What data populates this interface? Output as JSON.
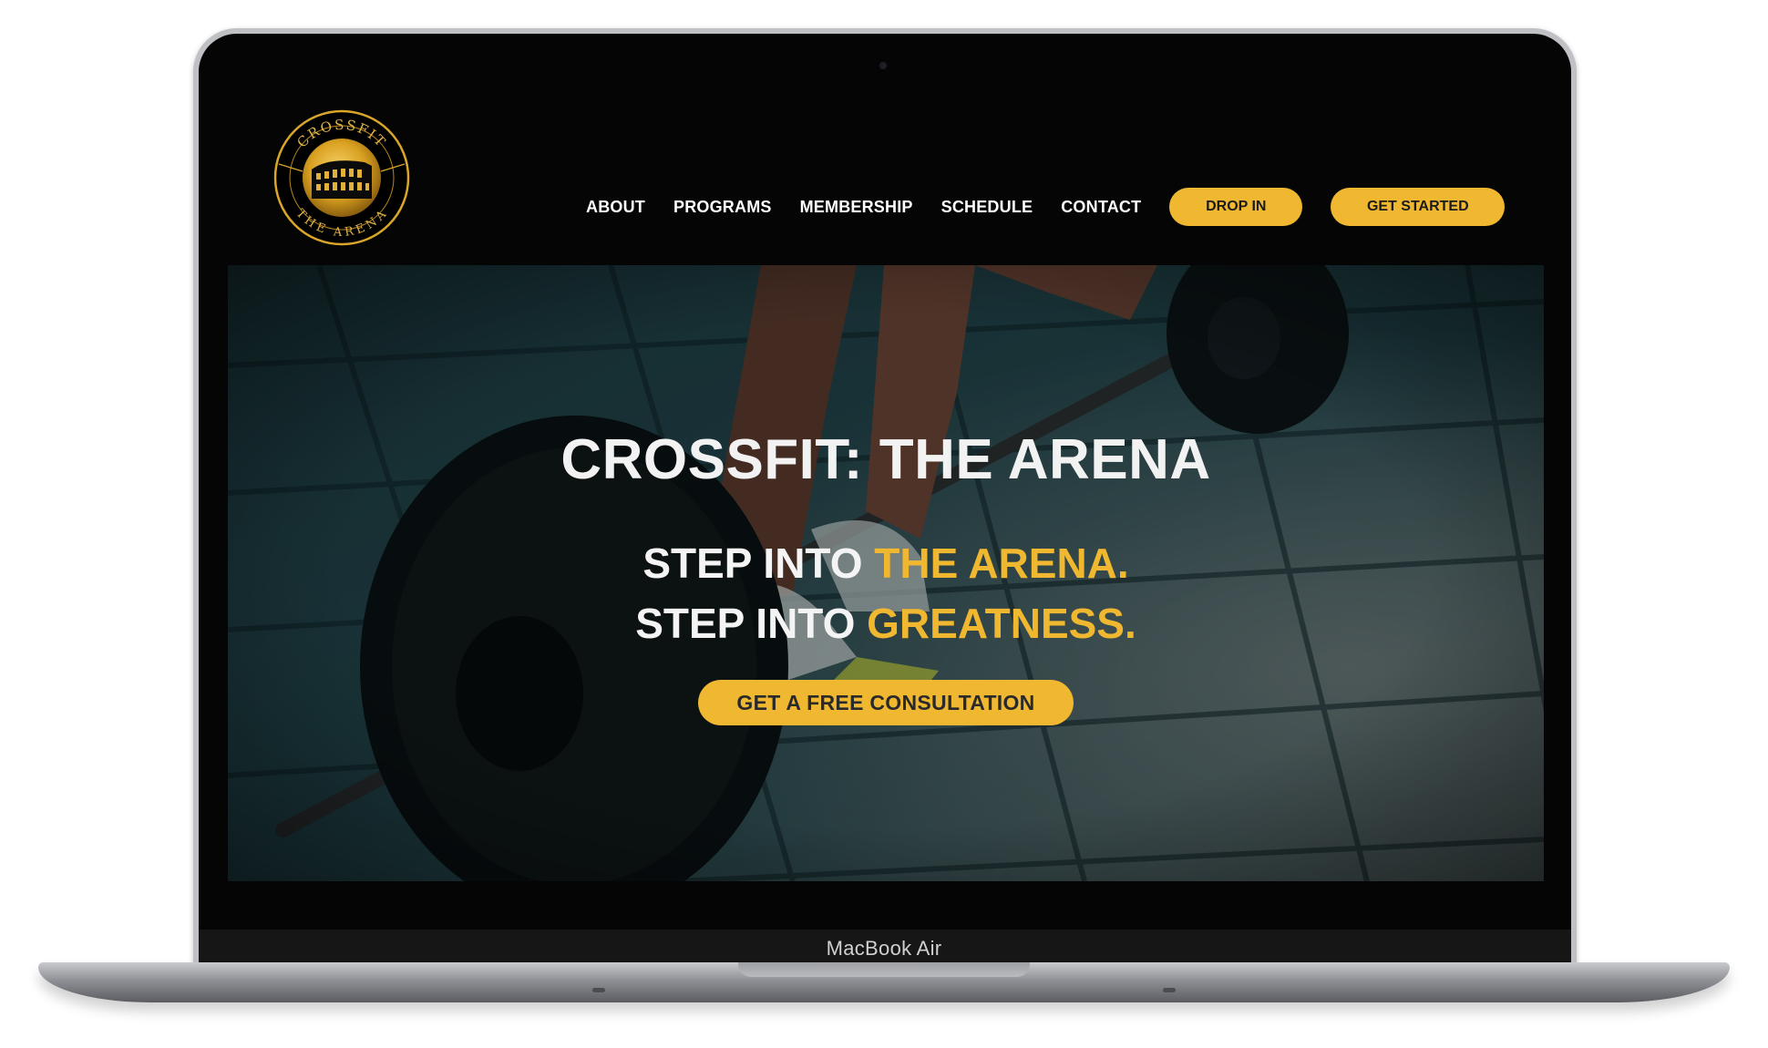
{
  "device": {
    "model_label": "MacBook Air"
  },
  "brand": {
    "logo_top_text": "CROSSFIT",
    "logo_bottom_text": "THE ARENA"
  },
  "nav": {
    "items": [
      {
        "label": "ABOUT"
      },
      {
        "label": "PROGRAMS"
      },
      {
        "label": "MEMBERSHIP"
      },
      {
        "label": "SCHEDULE"
      },
      {
        "label": "CONTACT"
      }
    ],
    "drop_in_label": "DROP IN",
    "get_started_label": "GET STARTED"
  },
  "hero": {
    "title": "CROSSFIT: THE ARENA",
    "tagline_1_prefix": "STEP INTO ",
    "tagline_1_accent": "THE ARENA.",
    "tagline_2_prefix": "STEP INTO ",
    "tagline_2_accent": "GREATNESS.",
    "cta_label": "GET A FREE CONSULTATION",
    "background_icon": "deadlift-barbell-photo"
  },
  "colors": {
    "accent": "#f0b731",
    "background": "#050505",
    "text": "#ffffff"
  }
}
